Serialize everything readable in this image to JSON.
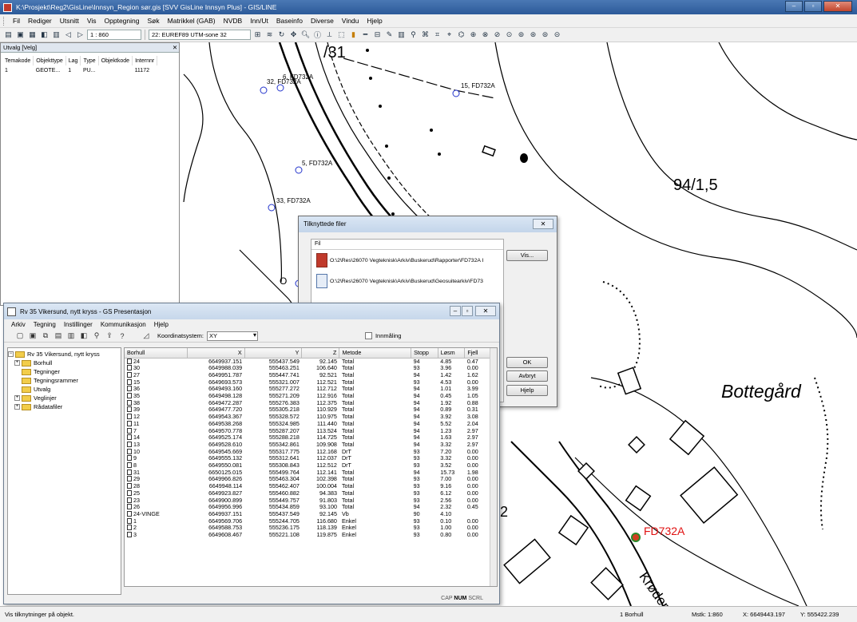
{
  "app": {
    "title": "K:\\Prosjekt\\Reg2\\GisLine\\Innsyn_Region sør.gis [SVV GisLine Innsyn Plus] - GIS/LINE"
  },
  "menu": [
    "Fil",
    "Rediger",
    "Utsnitt",
    "Vis",
    "Opptegning",
    "Søk",
    "Matrikkel (GAB)",
    "NVDB",
    "Inn/Ut",
    "Baseinfo",
    "Diverse",
    "Vindu",
    "Hjelp"
  ],
  "toolbar": {
    "scale": "1 : 860",
    "projection": "22: EUREF89 UTM-sone 32"
  },
  "utvalg": {
    "title": "Utvalg [Velg]",
    "columns": [
      "Temakode",
      "Objekttype",
      "Lag",
      "Type",
      "Objektkode",
      "Internnr"
    ],
    "rows": [
      [
        "1",
        "GEOTE...",
        "1",
        "PU...",
        "",
        "11172"
      ]
    ]
  },
  "map": {
    "labels": {
      "l31": "/31",
      "l941": "94/1,5",
      "bottegard": "Bottegård",
      "fd732a": "FD732A",
      "p6": "6, FD732A",
      "p32": "32, FD732A",
      "p15": "15, FD732A",
      "p5": "5, FD732A",
      "p33": "33, FD732A",
      "road": "Krødervei",
      "c2": "2",
      "cO": "O"
    }
  },
  "dialog": {
    "title": "Tilknyttede filer",
    "column": "Fil",
    "files": [
      "O:\\2\\Res\\26070 Vegteknisk\\Arkiv\\Buskerud\\Rapporter\\FD732A I",
      "O:\\2\\Res\\26070 Vegteknisk\\Arkiv\\Buskerud\\Geosuitearkiv\\FD73"
    ],
    "buttons": {
      "vis": "Vis...",
      "ok": "OK",
      "avbryt": "Avbryt",
      "hjelp": "Hjelp"
    }
  },
  "pwin": {
    "title": "Rv 35 Vikersund, nytt kryss - GS Presentasjon",
    "menu": [
      "Arkiv",
      "Tegning",
      "Instillinger",
      "Kommunikasjon",
      "Hjelp"
    ],
    "koord_label": "Koordinatsystem:",
    "koord_value": "XY",
    "innmaling": "Innmåling",
    "tree": {
      "root": "Rv 35 Vikersund, nytt kryss",
      "items": [
        "Borhull",
        "Tegninger",
        "Tegningsrammer",
        "Utvalg",
        "Veglinjer",
        "Rådatafiler"
      ]
    },
    "columns": [
      "Borhull",
      "X",
      "Y",
      "Z",
      "Metode",
      "Stopp",
      "Løsm",
      "Fjell"
    ],
    "rows": [
      [
        "24",
        "6649937.151",
        "555437.549",
        "92.145",
        "Total",
        "94",
        "4.85",
        "0.47"
      ],
      [
        "30",
        "6649988.039",
        "555463.251",
        "106.640",
        "Total",
        "93",
        "3.96",
        "0.00"
      ],
      [
        "27",
        "6649951.787",
        "555447.741",
        "92.521",
        "Total",
        "94",
        "1.42",
        "1.62"
      ],
      [
        "15",
        "6649693.573",
        "555321.007",
        "112.521",
        "Total",
        "93",
        "4.53",
        "0.00"
      ],
      [
        "36",
        "6649493.160",
        "555277.272",
        "112.712",
        "Total",
        "94",
        "1.01",
        "3.99"
      ],
      [
        "35",
        "6649498.128",
        "555271.209",
        "112.916",
        "Total",
        "94",
        "0.45",
        "1.05"
      ],
      [
        "38",
        "6649472.287",
        "555276.383",
        "112.375",
        "Total",
        "94",
        "1.92",
        "0.88"
      ],
      [
        "39",
        "6649477.720",
        "555305.218",
        "110.929",
        "Total",
        "94",
        "0.89",
        "0.31"
      ],
      [
        "12",
        "6649543.367",
        "555328.572",
        "110.975",
        "Total",
        "94",
        "3.92",
        "3.08"
      ],
      [
        "11",
        "6649538.268",
        "555324.985",
        "111.440",
        "Total",
        "94",
        "5.52",
        "2.04"
      ],
      [
        "7",
        "6649570.778",
        "555287.207",
        "113.524",
        "Total",
        "94",
        "1.23",
        "2.97"
      ],
      [
        "14",
        "6649525.174",
        "555288.218",
        "114.725",
        "Total",
        "94",
        "1.63",
        "2.97"
      ],
      [
        "13",
        "6649528.610",
        "555342.861",
        "109.908",
        "Total",
        "94",
        "3.32",
        "2.97"
      ],
      [
        "10",
        "6649545.669",
        "555317.775",
        "112.168",
        "DrT",
        "93",
        "7.20",
        "0.00"
      ],
      [
        "9",
        "6649555.132",
        "555312.641",
        "112.037",
        "DrT",
        "93",
        "3.32",
        "0.00"
      ],
      [
        "8",
        "6649550.081",
        "555308.843",
        "112.512",
        "DrT",
        "93",
        "3.52",
        "0.00"
      ],
      [
        "31",
        "6650125.015",
        "555499.764",
        "112.141",
        "Total",
        "94",
        "15.73",
        "1.98"
      ],
      [
        "29",
        "6649966.826",
        "555463.304",
        "102.398",
        "Total",
        "93",
        "7.00",
        "0.00"
      ],
      [
        "28",
        "6649948.114",
        "555462.407",
        "100.004",
        "Total",
        "93",
        "9.16",
        "0.00"
      ],
      [
        "25",
        "6649923.827",
        "555460.882",
        "94.383",
        "Total",
        "93",
        "6.12",
        "0.00"
      ],
      [
        "23",
        "6649900.899",
        "555449.757",
        "91.803",
        "Total",
        "93",
        "2.56",
        "0.00"
      ],
      [
        "26",
        "6649956.996",
        "555434.859",
        "93.100",
        "Total",
        "94",
        "2.32",
        "0.45"
      ],
      [
        "24-VINGE",
        "6649937.151",
        "555437.549",
        "92.145",
        "Vb",
        "90",
        "4.10",
        ""
      ],
      [
        "1",
        "6649569.706",
        "555244.705",
        "116.680",
        "Enkel",
        "93",
        "0.10",
        "0.00"
      ],
      [
        "2",
        "6649588.753",
        "555236.175",
        "118.139",
        "Enkel",
        "93",
        "1.00",
        "0.00"
      ],
      [
        "3",
        "6649608.467",
        "555221.108",
        "119.875",
        "Enkel",
        "93",
        "0.80",
        "0.00"
      ]
    ],
    "status": {
      "cap": "CAP",
      "num": "NUM",
      "scrl": "SCRL"
    }
  },
  "status": {
    "message": "Vis tilknytninger på objekt.",
    "selection": "1 Borhull",
    "scale": "Mstk: 1:860",
    "x": "X: 6649443.197",
    "y": "Y: 555422.239"
  }
}
